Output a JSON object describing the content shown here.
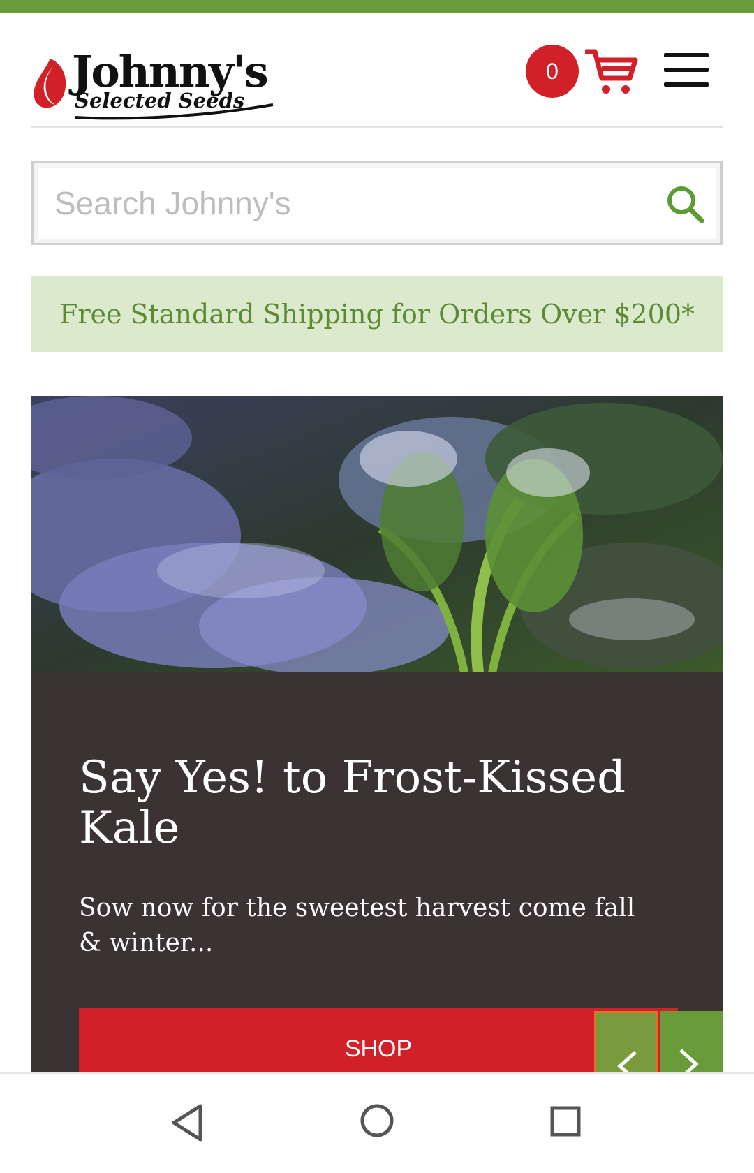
{
  "header": {
    "logo_name": "Johnny's",
    "logo_sub": "Selected Seeds",
    "cart_count": "0"
  },
  "search": {
    "placeholder": "Search Johnny's"
  },
  "banner": {
    "shipping_text": "Free Standard Shipping for Orders Over $200*"
  },
  "hero": {
    "title": "Say Yes! to Frost-Kissed Kale",
    "subtitle": "Sow now for the sweetest harvest come fall & winter...",
    "button_label": "SHOP"
  },
  "colors": {
    "brand_green": "#6a9b3b",
    "brand_red": "#d12027",
    "panel_dark": "#3a3233",
    "banner_bg": "#dbe9cd"
  },
  "icons": {
    "cart": "cart-icon",
    "menu": "hamburger-menu-icon",
    "search": "search-icon",
    "prev": "chevron-left-icon",
    "next": "chevron-right-icon"
  }
}
